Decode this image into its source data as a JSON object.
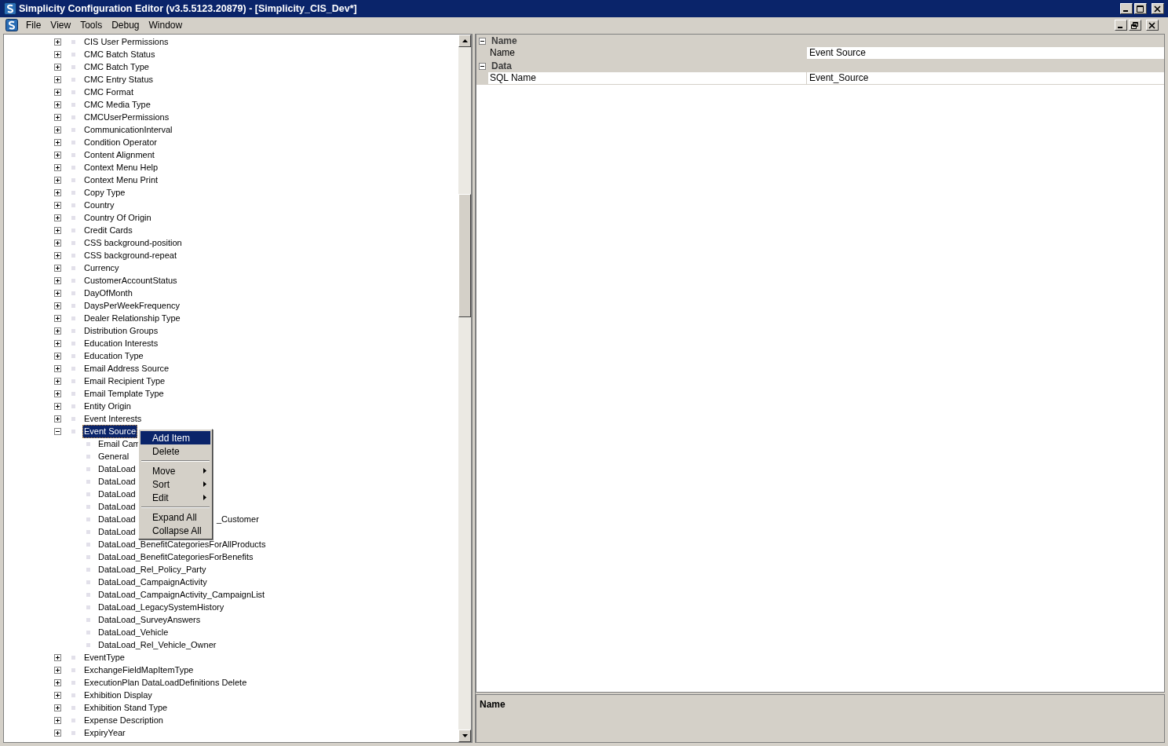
{
  "window": {
    "title": "Simplicity Configuration Editor (v3.5.5123.20879) - [Simplicity_CIS_Dev*]"
  },
  "menu": [
    "File",
    "View",
    "Tools",
    "Debug",
    "Window"
  ],
  "tree": [
    {
      "label": "CIS User Permissions",
      "expanded": false,
      "selected": false
    },
    {
      "label": "CMC Batch Status",
      "expanded": false,
      "selected": false
    },
    {
      "label": "CMC Batch Type",
      "expanded": false,
      "selected": false
    },
    {
      "label": "CMC Entry Status",
      "expanded": false,
      "selected": false
    },
    {
      "label": "CMC Format",
      "expanded": false,
      "selected": false
    },
    {
      "label": "CMC Media Type",
      "expanded": false,
      "selected": false
    },
    {
      "label": "CMCUserPermissions",
      "expanded": false,
      "selected": false
    },
    {
      "label": "CommunicationInterval",
      "expanded": false,
      "selected": false
    },
    {
      "label": "Condition Operator",
      "expanded": false,
      "selected": false
    },
    {
      "label": "Content Alignment",
      "expanded": false,
      "selected": false
    },
    {
      "label": "Context Menu Help",
      "expanded": false,
      "selected": false
    },
    {
      "label": "Context Menu Print",
      "expanded": false,
      "selected": false
    },
    {
      "label": "Copy Type",
      "expanded": false,
      "selected": false
    },
    {
      "label": "Country",
      "expanded": false,
      "selected": false
    },
    {
      "label": "Country Of Origin",
      "expanded": false,
      "selected": false
    },
    {
      "label": "Credit Cards",
      "expanded": false,
      "selected": false
    },
    {
      "label": "CSS background-position",
      "expanded": false,
      "selected": false
    },
    {
      "label": "CSS background-repeat",
      "expanded": false,
      "selected": false
    },
    {
      "label": "Currency",
      "expanded": false,
      "selected": false
    },
    {
      "label": "CustomerAccountStatus",
      "expanded": false,
      "selected": false
    },
    {
      "label": "DayOfMonth",
      "expanded": false,
      "selected": false
    },
    {
      "label": "DaysPerWeekFrequency",
      "expanded": false,
      "selected": false
    },
    {
      "label": "Dealer Relationship Type",
      "expanded": false,
      "selected": false
    },
    {
      "label": "Distribution Groups",
      "expanded": false,
      "selected": false
    },
    {
      "label": "Education Interests",
      "expanded": false,
      "selected": false
    },
    {
      "label": "Education Type",
      "expanded": false,
      "selected": false
    },
    {
      "label": "Email Address Source",
      "expanded": false,
      "selected": false
    },
    {
      "label": "Email Recipient Type",
      "expanded": false,
      "selected": false
    },
    {
      "label": "Email Template Type",
      "expanded": false,
      "selected": false
    },
    {
      "label": "Entity Origin",
      "expanded": false,
      "selected": false
    },
    {
      "label": "Event Interests",
      "expanded": false,
      "selected": false
    },
    {
      "label": "Event Source",
      "expanded": true,
      "selected": true,
      "children": [
        {
          "label": "Email Cam"
        },
        {
          "label": "General"
        },
        {
          "label": "DataLoad"
        },
        {
          "label": "DataLoad"
        },
        {
          "label": "DataLoad"
        },
        {
          "label": "DataLoad"
        },
        {
          "label": "DataLoad",
          "label_past_menu": "_Customer"
        },
        {
          "label": "DataLoad"
        },
        {
          "label": "DataLoad_BenefitCategoriesForAllProducts"
        },
        {
          "label": "DataLoad_BenefitCategoriesForBenefits"
        },
        {
          "label": "DataLoad_Rel_Policy_Party"
        },
        {
          "label": "DataLoad_CampaignActivity"
        },
        {
          "label": "DataLoad_CampaignActivity_CampaignList"
        },
        {
          "label": "DataLoad_LegacySystemHistory"
        },
        {
          "label": "DataLoad_SurveyAnswers"
        },
        {
          "label": "DataLoad_Vehicle"
        },
        {
          "label": "DataLoad_Rel_Vehicle_Owner"
        }
      ]
    },
    {
      "label": "EventType",
      "expanded": false,
      "selected": false
    },
    {
      "label": "ExchangeFieldMapItemType",
      "expanded": false,
      "selected": false
    },
    {
      "label": "ExecutionPlan DataLoadDefinitions Delete",
      "expanded": false,
      "selected": false
    },
    {
      "label": "Exhibition Display",
      "expanded": false,
      "selected": false
    },
    {
      "label": "Exhibition Stand Type",
      "expanded": false,
      "selected": false
    },
    {
      "label": "Expense Description",
      "expanded": false,
      "selected": false
    },
    {
      "label": "ExpiryYear",
      "expanded": false,
      "selected": false
    }
  ],
  "context_menu": [
    {
      "kind": "item",
      "label": "Add Item",
      "selected": true,
      "submenu": false
    },
    {
      "kind": "item",
      "label": "Delete",
      "selected": false,
      "submenu": false
    },
    {
      "kind": "separator"
    },
    {
      "kind": "item",
      "label": "Move",
      "selected": false,
      "submenu": true
    },
    {
      "kind": "item",
      "label": "Sort",
      "selected": false,
      "submenu": true
    },
    {
      "kind": "item",
      "label": "Edit",
      "selected": false,
      "submenu": true
    },
    {
      "kind": "separator"
    },
    {
      "kind": "item",
      "label": "Expand All",
      "selected": false,
      "submenu": false
    },
    {
      "kind": "item",
      "label": "Collapse All",
      "selected": false,
      "submenu": false
    }
  ],
  "properties": [
    {
      "category": "Name",
      "expanded": true,
      "rows": [
        {
          "name": "Name",
          "value": "Event Source",
          "selected": true
        }
      ]
    },
    {
      "category": "Data",
      "expanded": true,
      "rows": [
        {
          "name": "SQL Name",
          "value": "Event_Source",
          "selected": false
        }
      ]
    }
  ],
  "description": {
    "title": "Name"
  }
}
